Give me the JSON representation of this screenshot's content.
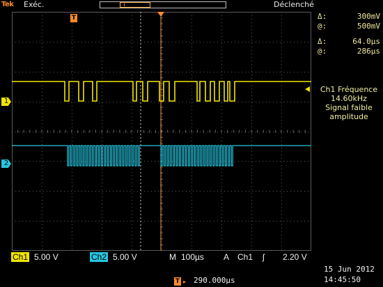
{
  "top": {
    "brand": "Tek",
    "run_state": "Exéc.",
    "trigger_state": "Déclenché"
  },
  "readouts": {
    "dv_label": "Δ:",
    "dv_value": "300mV",
    "v_label": "@:",
    "v_value": "500mV",
    "dt_label": "Δ:",
    "dt_value": "64.0µs",
    "t_label": "@:",
    "t_value": "286µs"
  },
  "measurement": {
    "line1": "Ch1 Fréquence",
    "line2": "14.60kHz",
    "line3": "Signal faible",
    "line4": "amplitude"
  },
  "channels": {
    "ch1_label": "Ch1",
    "ch1_scale": "5.00 V",
    "ch2_label": "Ch2",
    "ch2_scale": "5.00 V",
    "ch1_marker": "1",
    "ch2_marker": "2"
  },
  "timebase": {
    "mode": "M",
    "scale": "100µs",
    "trigger_mode": "A",
    "trigger_source": "Ch1",
    "trigger_slope": "ʃ",
    "trigger_level": "2.20 V",
    "position_label": "290.000µs",
    "trigger_marker": "T"
  },
  "datetime": {
    "date": "15 Jun  2012",
    "time": "14:45:50"
  },
  "colors": {
    "ch1": "#f2e600",
    "ch2": "#26c6e0",
    "grid": "#5a5a5a",
    "trigger": "#ff8a2a"
  }
}
